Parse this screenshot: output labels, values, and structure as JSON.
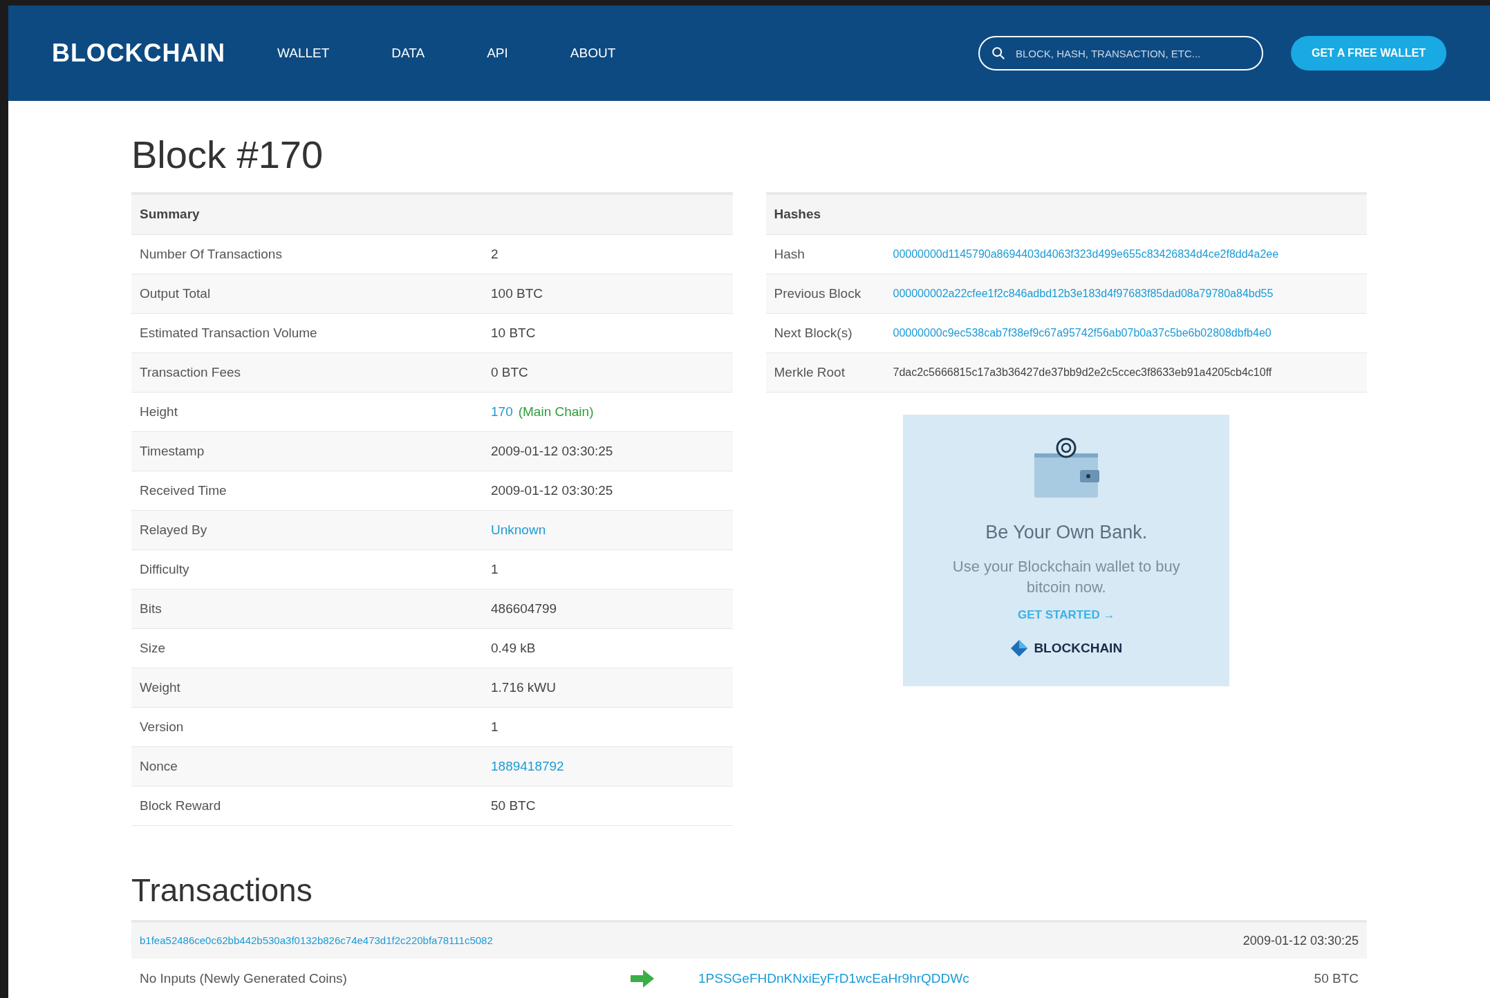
{
  "nav": {
    "logo": "BLOCKCHAIN",
    "links": [
      {
        "label": "WALLET"
      },
      {
        "label": "DATA"
      },
      {
        "label": "API"
      },
      {
        "label": "ABOUT"
      }
    ],
    "search": {
      "placeholder": "BLOCK, HASH, TRANSACTION, ETC..."
    },
    "cta": "GET A FREE WALLET"
  },
  "title": "Block #170",
  "summary": {
    "heading": "Summary",
    "rows": [
      {
        "label": "Number Of Transactions",
        "value": "2",
        "kind": "text"
      },
      {
        "label": "Output Total",
        "value": "100 BTC",
        "kind": "text"
      },
      {
        "label": "Estimated Transaction Volume",
        "value": "10 BTC",
        "kind": "text"
      },
      {
        "label": "Transaction Fees",
        "value": "0 BTC",
        "kind": "text"
      },
      {
        "label": "Height",
        "value": "170",
        "kind": "link",
        "note": "(Main Chain)"
      },
      {
        "label": "Timestamp",
        "value": "2009-01-12 03:30:25",
        "kind": "text"
      },
      {
        "label": "Received Time",
        "value": "2009-01-12 03:30:25",
        "kind": "text"
      },
      {
        "label": "Relayed By",
        "value": "Unknown",
        "kind": "link"
      },
      {
        "label": "Difficulty",
        "value": "1",
        "kind": "text"
      },
      {
        "label": "Bits",
        "value": "486604799",
        "kind": "text"
      },
      {
        "label": "Size",
        "value": "0.49 kB",
        "kind": "text"
      },
      {
        "label": "Weight",
        "value": "1.716 kWU",
        "kind": "text"
      },
      {
        "label": "Version",
        "value": "1",
        "kind": "text"
      },
      {
        "label": "Nonce",
        "value": "1889418792",
        "kind": "link"
      },
      {
        "label": "Block Reward",
        "value": "50 BTC",
        "kind": "text"
      }
    ]
  },
  "hashes": {
    "heading": "Hashes",
    "rows": [
      {
        "label": "Hash",
        "value": "00000000d1145790a8694403d4063f323d499e655c83426834d4ce2f8dd4a2ee",
        "kind": "link"
      },
      {
        "label": "Previous Block",
        "value": "000000002a22cfee1f2c846adbd12b3e183d4f97683f85dad08a79780a84bd55",
        "kind": "link"
      },
      {
        "label": "Next Block(s)",
        "value": "00000000c9ec538cab7f38ef9c67a95742f56ab07b0a37c5be6b02808dbfb4e0",
        "kind": "link"
      },
      {
        "label": "Merkle Root",
        "value": "7dac2c5666815c17a3b36427de37bb9d2e2c5ccec3f8633eb91a4205cb4c10ff",
        "kind": "text"
      }
    ]
  },
  "ad": {
    "headline": "Be Your Own Bank.",
    "body": "Use your Blockchain wallet to buy bitcoin now.",
    "link": "GET STARTED →",
    "brand": "BLOCKCHAIN"
  },
  "transactions": {
    "heading": "Transactions",
    "items": [
      {
        "hash": "b1fea52486ce0c62bb442b530a3f0132b826c74e473d1f2c220bfa78111c5082",
        "time": "2009-01-12 03:30:25",
        "input": "No Inputs (Newly Generated Coins)",
        "output": "1PSSGeFHDnKNxiEyFrD1wcEaHr9hrQDDWc",
        "amount": "50 BTC"
      }
    ]
  }
}
